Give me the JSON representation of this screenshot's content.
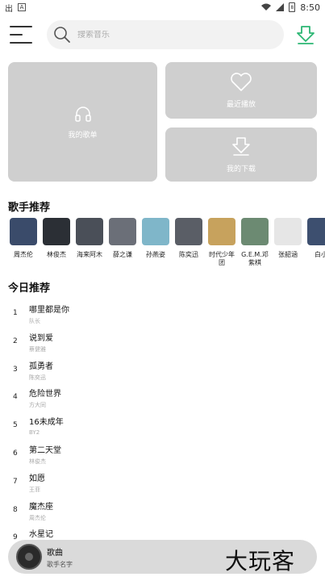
{
  "status_bar": {
    "time": "8:50",
    "left_icon_1": "出",
    "left_icon_2": "A",
    "battery": "8"
  },
  "search": {
    "placeholder": "搜索音乐"
  },
  "cards": {
    "my_playlist": "我的歌单",
    "recent": "最近播放",
    "downloads": "我的下载"
  },
  "singers_section": {
    "title": "歌手推荐",
    "items": [
      {
        "name": "周杰伦",
        "color": "#3a4b6a"
      },
      {
        "name": "林俊杰",
        "color": "#2b2f35"
      },
      {
        "name": "海来阿木",
        "color": "#4a4f58"
      },
      {
        "name": "薛之谦",
        "color": "#6b6f78"
      },
      {
        "name": "孙燕姿",
        "color": "#7fb6c9"
      },
      {
        "name": "陈奕迅",
        "color": "#5a5e66"
      },
      {
        "name": "时代少年团",
        "color": "#c7a25d"
      },
      {
        "name": "G.E.M.邓紫棋",
        "color": "#6c8a72"
      },
      {
        "name": "张韶涵",
        "color": "#e6e6e6"
      },
      {
        "name": "白小",
        "color": "#3d4f6f"
      }
    ]
  },
  "today_section": {
    "title": "今日推荐",
    "songs": [
      {
        "index": "1",
        "title": "哪里都是你",
        "artist": "队长"
      },
      {
        "index": "2",
        "title": "说到爱",
        "artist": "蔡健雅"
      },
      {
        "index": "3",
        "title": "孤勇者",
        "artist": "陈奕迅"
      },
      {
        "index": "4",
        "title": "危险世界",
        "artist": "方大同"
      },
      {
        "index": "5",
        "title": "16未成年",
        "artist": "BY2"
      },
      {
        "index": "6",
        "title": "第二天堂",
        "artist": "林俊杰"
      },
      {
        "index": "7",
        "title": "如愿",
        "artist": "王菲"
      },
      {
        "index": "8",
        "title": "魔杰座",
        "artist": "周杰伦"
      },
      {
        "index": "9",
        "title": "水星记",
        "artist": ""
      }
    ]
  },
  "player": {
    "song": "歌曲",
    "artist": "歌手名字"
  },
  "watermark": "大玩客"
}
